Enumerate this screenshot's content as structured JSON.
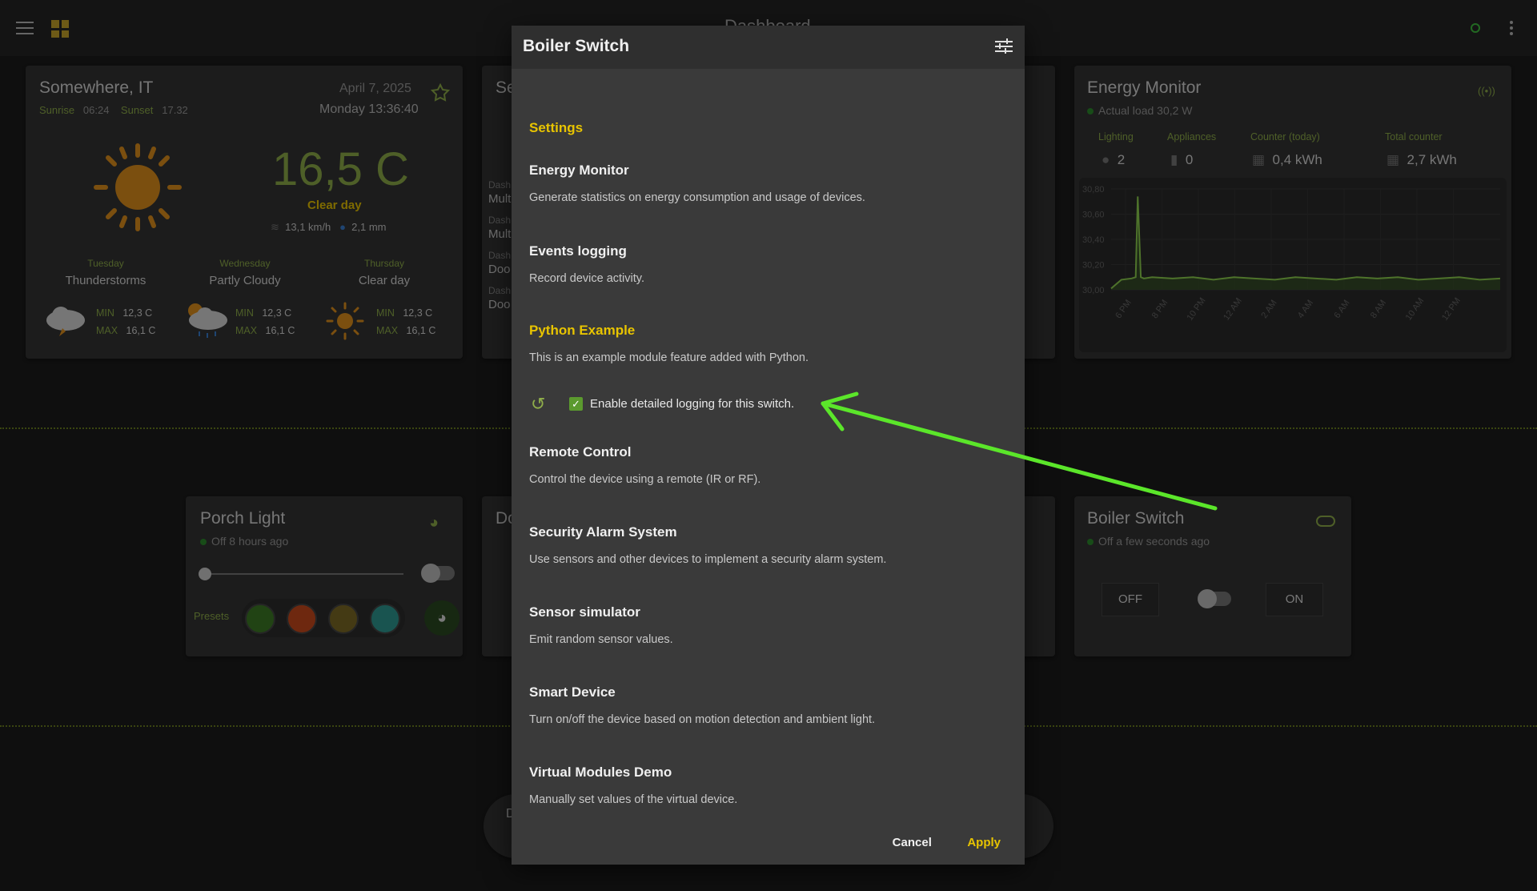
{
  "topbar": {
    "title": "Dashboard"
  },
  "weather": {
    "location": "Somewhere, IT",
    "date": "April 7, 2025",
    "time": "Monday 13:36:40",
    "sunrise_label": "Sunrise",
    "sunrise": "06:24",
    "sunset_label": "Sunset",
    "sunset": "17.32",
    "temp": "16,5 C",
    "condition": "Clear day",
    "wind": "13,1 km/h",
    "rain": "2,1 mm",
    "forecast": [
      {
        "day": "Tuesday",
        "cond": "Thunderstorms",
        "min_label": "MIN",
        "min": "12,3 C",
        "max_label": "MAX",
        "max": "16,1 C"
      },
      {
        "day": "Wednesday",
        "cond": "Partly Cloudy",
        "min_label": "MIN",
        "min": "12,3 C",
        "max_label": "MAX",
        "max": "16,1 C"
      },
      {
        "day": "Thursday",
        "cond": "Clear day",
        "min_label": "MIN",
        "min": "12,3 C",
        "max_label": "MAX",
        "max": "16,1 C"
      }
    ]
  },
  "partial_cards": {
    "se": "Se",
    "dash_items": [
      {
        "a": "Dash",
        "b": "Mult"
      },
      {
        "a": "Dash",
        "b": "Mult"
      },
      {
        "a": "Dash",
        "b": "Doo"
      },
      {
        "a": "Dash",
        "b": "Doo"
      }
    ],
    "do": "Do",
    "bottom": "D"
  },
  "energy": {
    "title": "Energy Monitor",
    "load": "Actual load 30,2 W",
    "cols": [
      {
        "label": "Lighting",
        "value": "2"
      },
      {
        "label": "Appliances",
        "value": "0"
      },
      {
        "label": "Counter (today)",
        "value": "0,4 kWh"
      },
      {
        "label": "Total counter",
        "value": "2,7 kWh"
      }
    ],
    "y_ticks": [
      "30,80",
      "30,60",
      "30,40",
      "30,20",
      "30,00"
    ],
    "x_ticks": [
      "6 PM",
      "8 PM",
      "10 PM",
      "12 AM",
      "2 AM",
      "4 AM",
      "6 AM",
      "8 AM",
      "10 AM",
      "12 PM"
    ]
  },
  "chart_data": {
    "type": "line",
    "y_ticks": [
      "30,80",
      "30,60",
      "30,40",
      "30,20",
      "30,00"
    ],
    "x_ticks": [
      "6 PM",
      "8 PM",
      "10 PM",
      "12 AM",
      "2 AM",
      "4 AM",
      "6 AM",
      "8 AM",
      "10 AM",
      "12 PM"
    ],
    "ylim": [
      30.0,
      30.8
    ],
    "series": [
      {
        "x": [
          0,
          0.5,
          1.0,
          1.2,
          1.3,
          1.45,
          1.6,
          2,
          3,
          4,
          5,
          6,
          7,
          8,
          9,
          10,
          11,
          12,
          13,
          14,
          15,
          16,
          17,
          18,
          19
        ],
        "values": [
          30.01,
          30.08,
          30.09,
          30.1,
          30.74,
          30.1,
          30.09,
          30.1,
          30.09,
          30.1,
          30.08,
          30.1,
          30.09,
          30.08,
          30.1,
          30.09,
          30.08,
          30.1,
          30.09,
          30.1,
          30.08,
          30.09,
          30.1,
          30.08,
          30.09
        ]
      }
    ],
    "colors": {
      "line": "#8fd14f",
      "fill": "#3c5a2a"
    }
  },
  "porch": {
    "title": "Porch Light",
    "status": "Off 8 hours ago",
    "presets_label": "Presets",
    "presets": [
      "#3d7a26",
      "#c8491c",
      "#7d6a25",
      "#2f9a92"
    ],
    "slider": 0
  },
  "boiler_card": {
    "title": "Boiler Switch",
    "status": "Off a few seconds ago",
    "off": "OFF",
    "on": "ON"
  },
  "modal": {
    "title": "Boiler Switch",
    "settings_label": "Settings",
    "sections": [
      {
        "title": "Energy Monitor",
        "desc": "Generate statistics on energy consumption and usage of devices."
      },
      {
        "title": "Events logging",
        "desc": "Record device activity."
      },
      {
        "title": "Python Example",
        "desc": "This is an example module feature added with Python."
      },
      {
        "title": "Remote Control",
        "desc": "Control the device using a remote (IR or RF)."
      },
      {
        "title": "Security Alarm System",
        "desc": "Use sensors and other devices to implement a security alarm system."
      },
      {
        "title": "Sensor simulator",
        "desc": "Emit random sensor values."
      },
      {
        "title": "Smart Device",
        "desc": "Turn on/off the device based on motion detection and ambient light."
      },
      {
        "title": "Virtual Modules Demo",
        "desc": "Manually set values of the virtual device."
      }
    ],
    "checkbox_label": "Enable detailed logging for this switch.",
    "checkbox_checked": true,
    "cancel": "Cancel",
    "apply": "Apply"
  },
  "colors": {
    "accent": "#e8c400",
    "green": "#8fae4a",
    "arrow": "#5be62a"
  }
}
